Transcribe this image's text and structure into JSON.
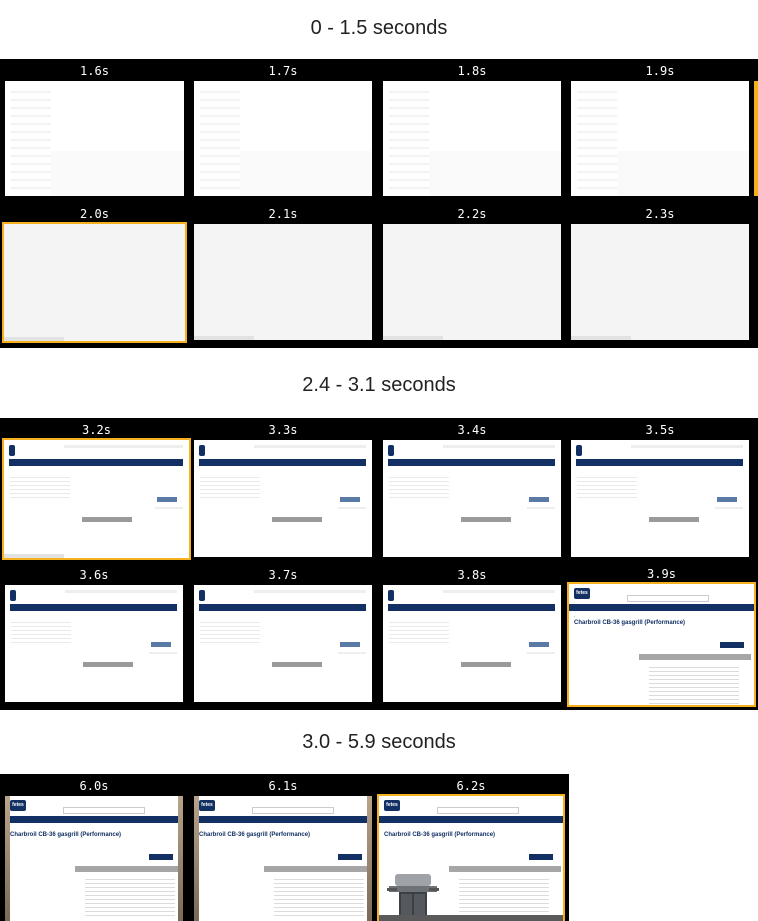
{
  "sections": [
    {
      "title": "0 - 1.5 seconds"
    },
    {
      "title": "2.4 - 3.1 seconds"
    },
    {
      "title": "3.0 - 5.9 seconds"
    }
  ],
  "frames_a": [
    {
      "label": "1.6s"
    },
    {
      "label": "1.7s"
    },
    {
      "label": "1.8s"
    },
    {
      "label": "1.9s"
    },
    {
      "label": "2.0s"
    },
    {
      "label": "2.1s"
    },
    {
      "label": "2.2s"
    },
    {
      "label": "2.3s"
    }
  ],
  "frames_b": [
    {
      "label": "3.2s"
    },
    {
      "label": "3.3s"
    },
    {
      "label": "3.4s"
    },
    {
      "label": "3.5s"
    },
    {
      "label": "3.6s"
    },
    {
      "label": "3.7s"
    },
    {
      "label": "3.8s"
    },
    {
      "label": "3.9s"
    }
  ],
  "frames_c": [
    {
      "label": "6.0s"
    },
    {
      "label": "6.1s"
    },
    {
      "label": "6.2s"
    }
  ],
  "page": {
    "logo": "fetes",
    "product_title": "Charbroil CB-36 gasgrill (Performance)",
    "accent_color": "#123063",
    "highlight_color": "#f5b01c"
  }
}
